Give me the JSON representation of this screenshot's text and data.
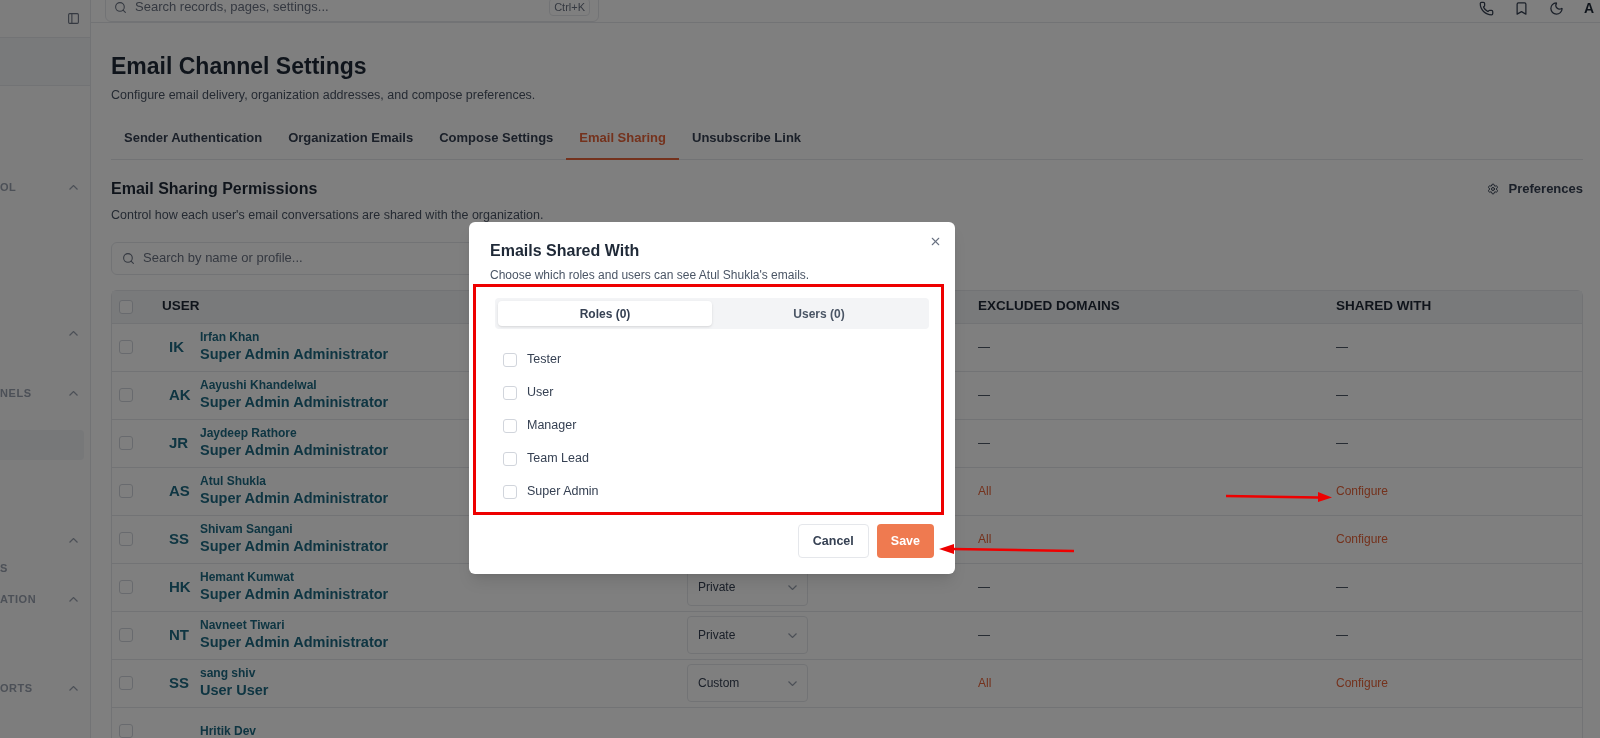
{
  "sidebar": {
    "groups": [
      {
        "kind": "group",
        "label": "OL"
      },
      {
        "kind": "group"
      },
      {
        "kind": "group",
        "label": "NELS"
      },
      {
        "kind": "group"
      },
      {
        "kind": "item",
        "label": "S"
      },
      {
        "kind": "group",
        "label": "ATION"
      },
      {
        "kind": "group",
        "label": "ORTS"
      }
    ]
  },
  "topbar": {
    "search": {
      "placeholder": "Search records, pages, settings...",
      "shortcut": "Ctrl+K"
    },
    "avatar": "A"
  },
  "page": {
    "title": "Email Channel Settings",
    "subtitle": "Configure email delivery, organization addresses, and compose preferences."
  },
  "tabs": [
    {
      "label": "Sender Authentication",
      "selected": false
    },
    {
      "label": "Organization Emails",
      "selected": false
    },
    {
      "label": "Compose Settings",
      "selected": false
    },
    {
      "label": "Email Sharing",
      "selected": true
    },
    {
      "label": "Unsubscribe Link",
      "selected": false
    }
  ],
  "section": {
    "title": "Email Sharing Permissions",
    "description": "Control how each user's email conversations are shared with the organization.",
    "preferences": "Preferences",
    "search_placeholder": "Search by name or profile..."
  },
  "table": {
    "columns": [
      "USER",
      "EXCLUDED DOMAINS",
      "SHARED WITH"
    ],
    "header_checked": false,
    "rows": [
      {
        "initials": "IK",
        "name": "Irfan Khan",
        "role": "Super Admin Administrator",
        "checked": false,
        "excluded": "—",
        "shared": "—",
        "custom": false
      },
      {
        "initials": "AK",
        "name": "Aayushi Khandelwal",
        "role": "Super Admin Administrator",
        "checked": false,
        "excluded": "—",
        "shared": "—",
        "custom": false
      },
      {
        "initials": "JR",
        "name": "Jaydeep Rathore",
        "role": "Super Admin Administrator",
        "checked": false,
        "excluded": "—",
        "shared": "—",
        "custom": false
      },
      {
        "initials": "AS",
        "name": "Atul Shukla",
        "role": "Super Admin Administrator",
        "checked": false,
        "excluded": "All",
        "shared": "Configure",
        "custom": true
      },
      {
        "initials": "SS",
        "name": "Shivam Sangani",
        "role": "Super Admin Administrator",
        "checked": false,
        "excluded": "All",
        "shared": "Configure",
        "custom": true
      },
      {
        "initials": "HK",
        "name": "Hemant Kumwat",
        "role": "Super Admin Administrator",
        "checked": false,
        "visibility": "Private",
        "excluded": "—",
        "shared": "—",
        "custom": false
      },
      {
        "initials": "NT",
        "name": "Navneet Tiwari",
        "role": "Super Admin Administrator",
        "checked": false,
        "visibility": "Private",
        "excluded": "—",
        "shared": "—",
        "custom": false
      },
      {
        "initials": "SS",
        "name": "sang shiv",
        "role": "User User",
        "checked": false,
        "visibility": "Custom",
        "excluded": "All",
        "shared": "Configure",
        "custom": true
      },
      {
        "name": "Hritik Dev",
        "checked": false
      }
    ]
  },
  "modal": {
    "title": "Emails Shared With",
    "description": "Choose which roles and users can see Atul Shukla's emails.",
    "tabs": [
      {
        "label": "Roles (0)",
        "selected": true
      },
      {
        "label": "Users (0)",
        "selected": false
      }
    ],
    "roles": [
      {
        "label": "Tester",
        "checked": false
      },
      {
        "label": "User",
        "checked": false
      },
      {
        "label": "Manager",
        "checked": false
      },
      {
        "label": "Team Lead",
        "checked": false
      },
      {
        "label": "Super Admin",
        "checked": false
      }
    ],
    "buttons": [
      {
        "label": "Cancel",
        "kind": "secondary"
      },
      {
        "label": "Save",
        "kind": "primary"
      }
    ]
  }
}
